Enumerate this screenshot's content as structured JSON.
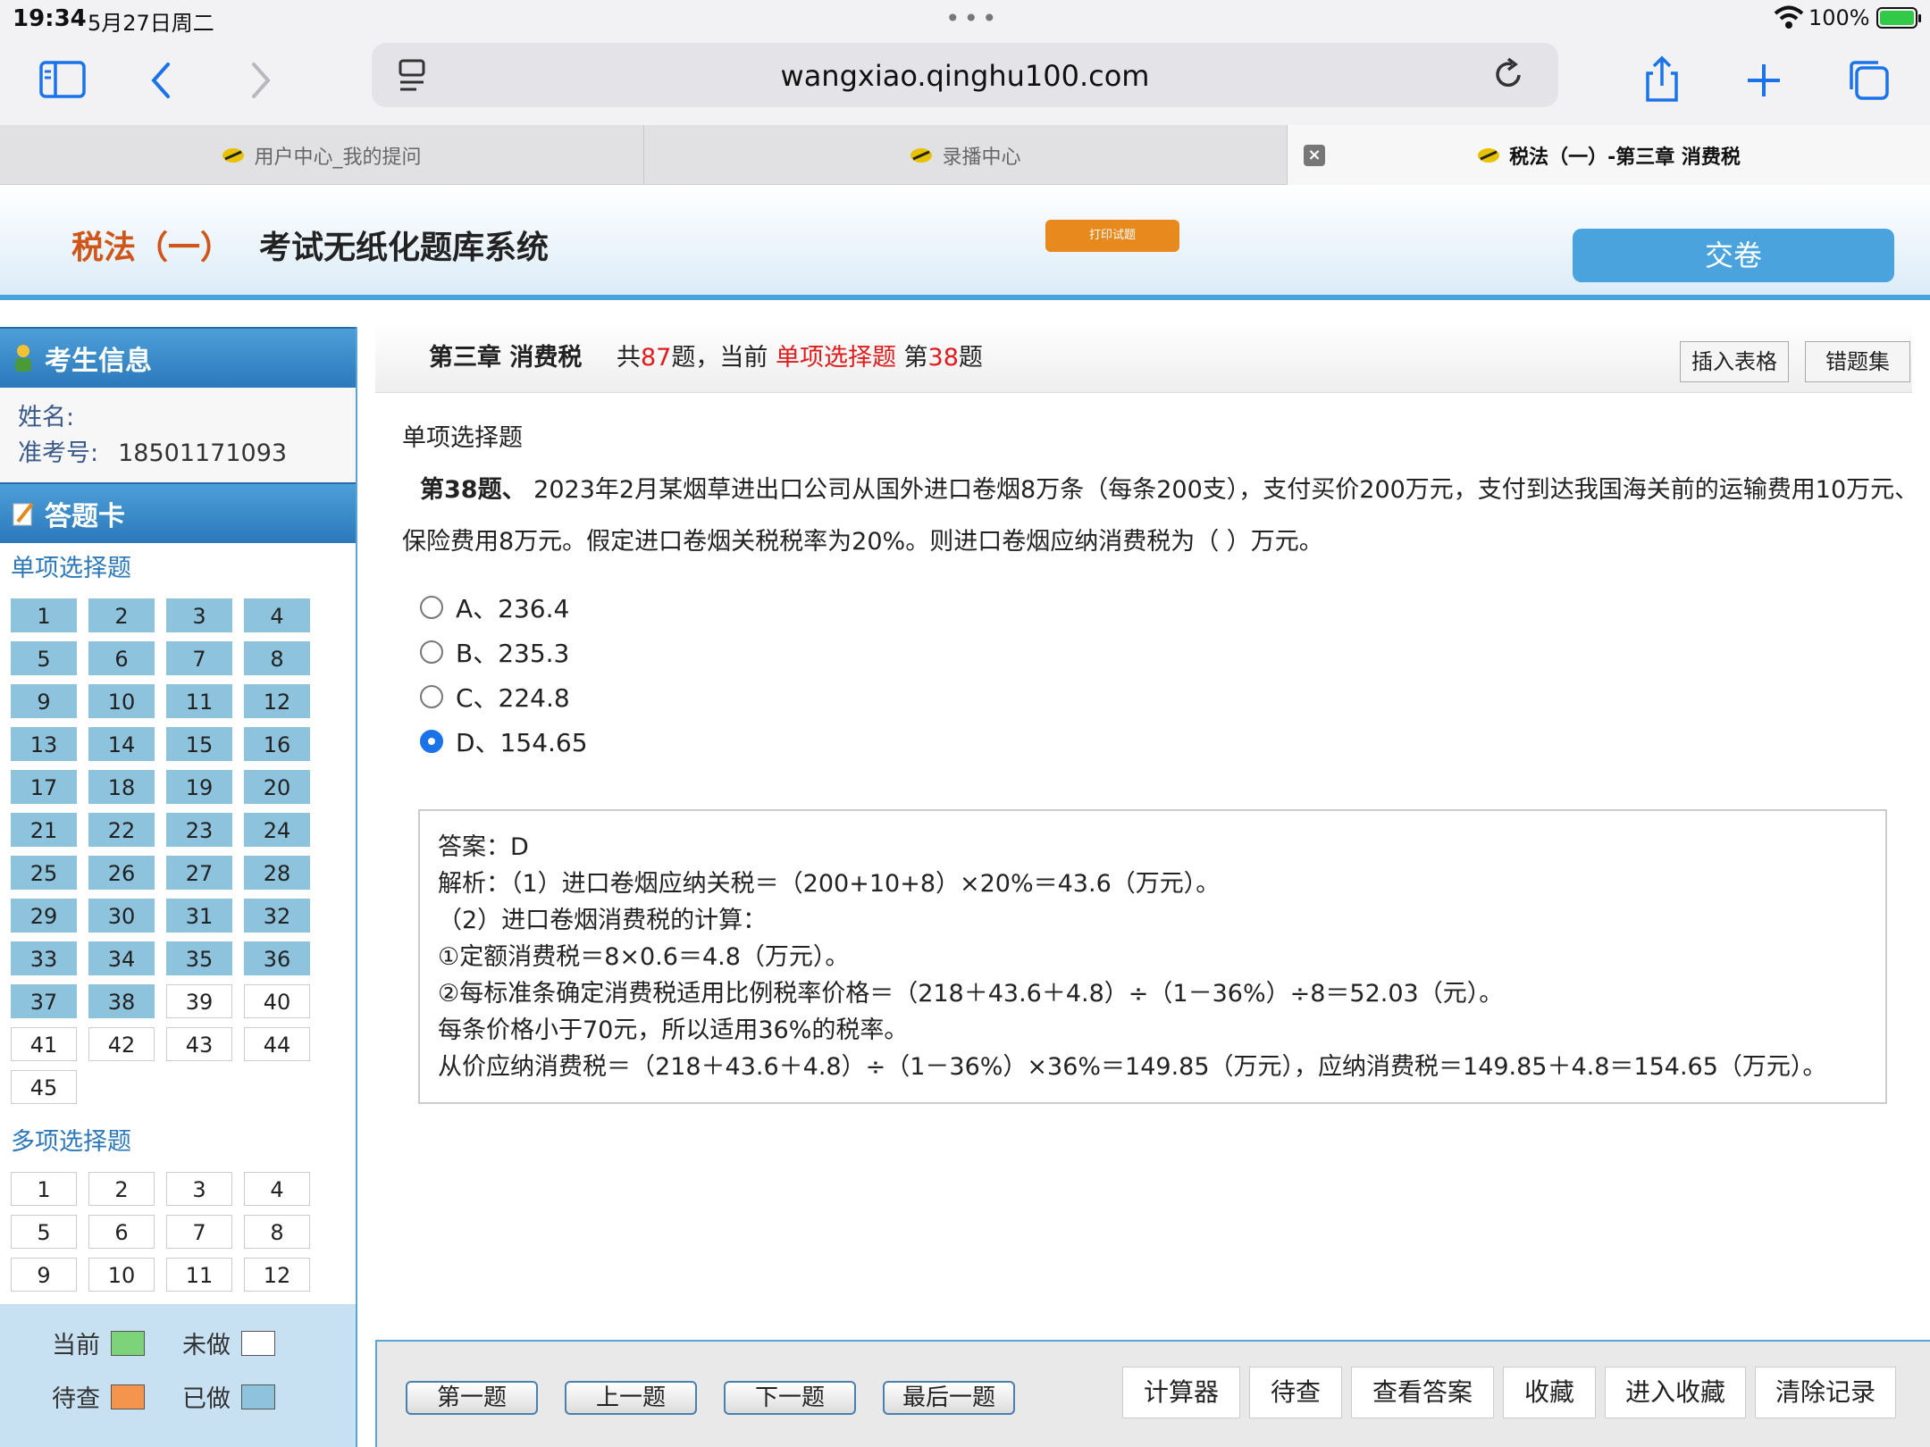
{
  "status": {
    "time": "19:34",
    "date": "5月27日周二",
    "battery": "100%"
  },
  "browser": {
    "url": "wangxiao.qinghu100.com",
    "tabs": [
      {
        "label": "用户中心_我的提问"
      },
      {
        "label": "录播中心"
      },
      {
        "label": "税法（一）-第三章 消费税"
      }
    ]
  },
  "header": {
    "subject": "税法（一）",
    "system": "考试无纸化题库系统",
    "print_label": "打印试题",
    "submit_label": "交卷"
  },
  "sidebar": {
    "candidate_title": "考生信息",
    "name_label": "姓名:",
    "id_label": "准考号:",
    "id_value": "18501171093",
    "card_title": "答题卡",
    "single_label": "单项选择题",
    "single_done": 38,
    "single": [
      "1",
      "2",
      "3",
      "4",
      "5",
      "6",
      "7",
      "8",
      "9",
      "10",
      "11",
      "12",
      "13",
      "14",
      "15",
      "16",
      "17",
      "18",
      "19",
      "20",
      "21",
      "22",
      "23",
      "24",
      "25",
      "26",
      "27",
      "28",
      "29",
      "30",
      "31",
      "32",
      "33",
      "34",
      "35",
      "36",
      "37",
      "38",
      "39",
      "40",
      "41",
      "42",
      "43",
      "44",
      "45"
    ],
    "multi_label": "多项选择题",
    "multi": [
      "1",
      "2",
      "3",
      "4",
      "5",
      "6",
      "7",
      "8",
      "9",
      "10",
      "11",
      "12"
    ],
    "legend": {
      "current": "当前",
      "undone": "未做",
      "review": "待查",
      "done": "已做"
    },
    "legend_colors": {
      "current": "#7dd37a",
      "undone": "#ffffff",
      "review": "#f5954d",
      "done": "#8ec3dd"
    }
  },
  "crumb": {
    "chapter": "第三章 消费税",
    "total_pre": "共",
    "total": "87",
    "total_post": "题，当前",
    "qtype": "单项选择题",
    "cur_pre": "第",
    "current": "38",
    "cur_post": "题",
    "insert_table": "插入表格",
    "wrong_set": "错题集"
  },
  "question": {
    "type": "单项选择题",
    "number": "第38题、",
    "text": "2023年2月某烟草进出口公司从国外进口卷烟8万条（每条200支），支付买价200万元，支付到达我国海关前的运输费用10万元、保险费用8万元。假定进口卷烟关税税率为20%。则进口卷烟应纳消费税为（ ）万元。",
    "options": [
      "A、236.4",
      "B、235.3",
      "C、224.8",
      "D、154.65"
    ],
    "selected": 3
  },
  "answer": {
    "lines": [
      "答案：D",
      "解析：（1）进口卷烟应纳关税＝（200+10+8）×20%＝43.6（万元）。",
      "（2）进口卷烟消费税的计算：",
      "①定额消费税＝8×0.6＝4.8（万元）。",
      "②每标准条确定消费税适用比例税率价格＝（218＋43.6＋4.8）÷（1－36%）÷8＝52.03（元）。",
      "每条价格小于70元，所以适用36%的税率。",
      "从价应纳消费税＝（218＋43.6＋4.8）÷（1－36%）×36%＝149.85（万元），应纳消费税＝149.85＋4.8＝154.65（万元）。"
    ]
  },
  "bottom": {
    "nav": [
      "第一题",
      "上一题",
      "下一题",
      "最后一题"
    ],
    "tools": [
      "计算器",
      "待查",
      "查看答案",
      "收藏",
      "进入收藏",
      "清除记录"
    ]
  }
}
